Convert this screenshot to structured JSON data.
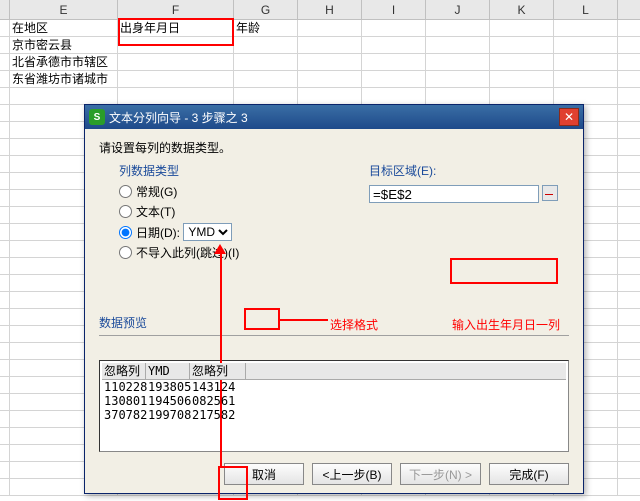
{
  "sheet": {
    "columns": [
      "E",
      "F",
      "G",
      "H",
      "I",
      "J",
      "K",
      "L"
    ],
    "rows": [
      {
        "E": "在地区",
        "F": "出身年月日",
        "G": "年龄"
      },
      {
        "E": "京市密云县",
        "F": "",
        "G": ""
      },
      {
        "E": "北省承德市市辖区",
        "F": "",
        "G": ""
      },
      {
        "E": "东省潍坊市诸城市",
        "F": "",
        "G": ""
      }
    ]
  },
  "dialog": {
    "title": "文本分列向导 - 3 步骤之 3",
    "instruction": "请设置每列的数据类型。",
    "group_data_type": "列数据类型",
    "radios": {
      "general": "常规(G)",
      "text": "文本(T)",
      "date": "日期(D):",
      "skip": "不导入此列(跳过)(I)"
    },
    "date_format_options": [
      "YMD"
    ],
    "date_format_selected": "YMD",
    "target_label": "目标区域(E):",
    "target_value": "=$E$2",
    "preview_label": "数据预览",
    "preview_headers": {
      "h1": "忽略列",
      "h2": "YMD",
      "h3": "忽略列"
    },
    "preview_data": [
      {
        "c1": "110228",
        "c2": "193805",
        "c3": "143124"
      },
      {
        "c1": "130801",
        "c2": "194506",
        "c3": "082561"
      },
      {
        "c1": "370782",
        "c2": "199708",
        "c3": "217582"
      }
    ],
    "buttons": {
      "cancel": "取消",
      "prev": "<上一步(B)",
      "next": "下一步(N) >",
      "finish": "完成(F)"
    }
  },
  "annotations": {
    "select_format": "选择格式",
    "enter_birth_col": "输入出生年月日一列"
  },
  "icons": {
    "app_icon_letter": "S",
    "close_glyph": "✕"
  }
}
